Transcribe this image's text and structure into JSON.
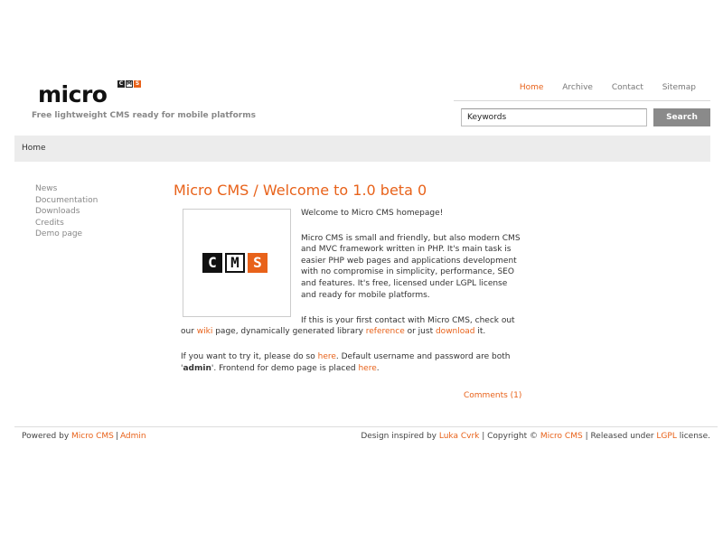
{
  "logo": {
    "word": "micro",
    "cms_letters": [
      "C",
      "M",
      "S"
    ],
    "tagline": "Free lightweight CMS ready for mobile platforms"
  },
  "top_nav": {
    "items": [
      {
        "label": "Home",
        "active": true
      },
      {
        "label": "Archive",
        "active": false
      },
      {
        "label": "Contact",
        "active": false
      },
      {
        "label": "Sitemap",
        "active": false
      }
    ]
  },
  "search": {
    "value": "Keywords",
    "button_label": "Search"
  },
  "breadcrumb": "Home",
  "sidebar": {
    "items": [
      "News",
      "Documentation",
      "Downloads",
      "Credits",
      "Demo page"
    ]
  },
  "article": {
    "title": "Micro CMS / Welcome to 1.0 beta 0",
    "image_letters": [
      "C",
      "M",
      "S"
    ],
    "p1": "Welcome to Micro CMS homepage!",
    "p2": "Micro CMS is small and friendly, but also modern CMS and MVC framework written in PHP. It's main task is easier PHP web pages and applications development with no compromise in simplicity, performance, SEO and features. It's free, licensed under LGPL license and ready for mobile platforms.",
    "p3": {
      "t1": "If this is your first contact with Micro CMS, check out our ",
      "link_wiki": "wiki",
      "t2": " page, dynamically generated library ",
      "link_reference": "reference",
      "t3": " or just ",
      "link_download": "download",
      "t4": " it."
    },
    "p4": {
      "t1": "If you want to try it, please do so ",
      "link_here1": "here",
      "t2": ". Default username and password are both '",
      "bold_admin": "admin",
      "t3": "'. Frontend for demo page is placed ",
      "link_here2": "here",
      "t4": "."
    },
    "comments_link": "Comments (1)"
  },
  "footer": {
    "left": {
      "t1": "Powered by ",
      "link_microcms": "Micro CMS",
      "sep": "|",
      "link_admin": "Admin"
    },
    "right": {
      "t1": "Design inspired by ",
      "link_luka": "Luka Cvrk",
      "t2": " | Copyright © ",
      "link_microcms": "Micro CMS",
      "t3": " | Released under ",
      "link_lgpl": "LGPL",
      "t4": " license."
    }
  },
  "colors": {
    "accent": "#e8621a",
    "muted_text": "#888888",
    "bar_bg": "#ececec",
    "search_button": "#8a8a8a"
  }
}
